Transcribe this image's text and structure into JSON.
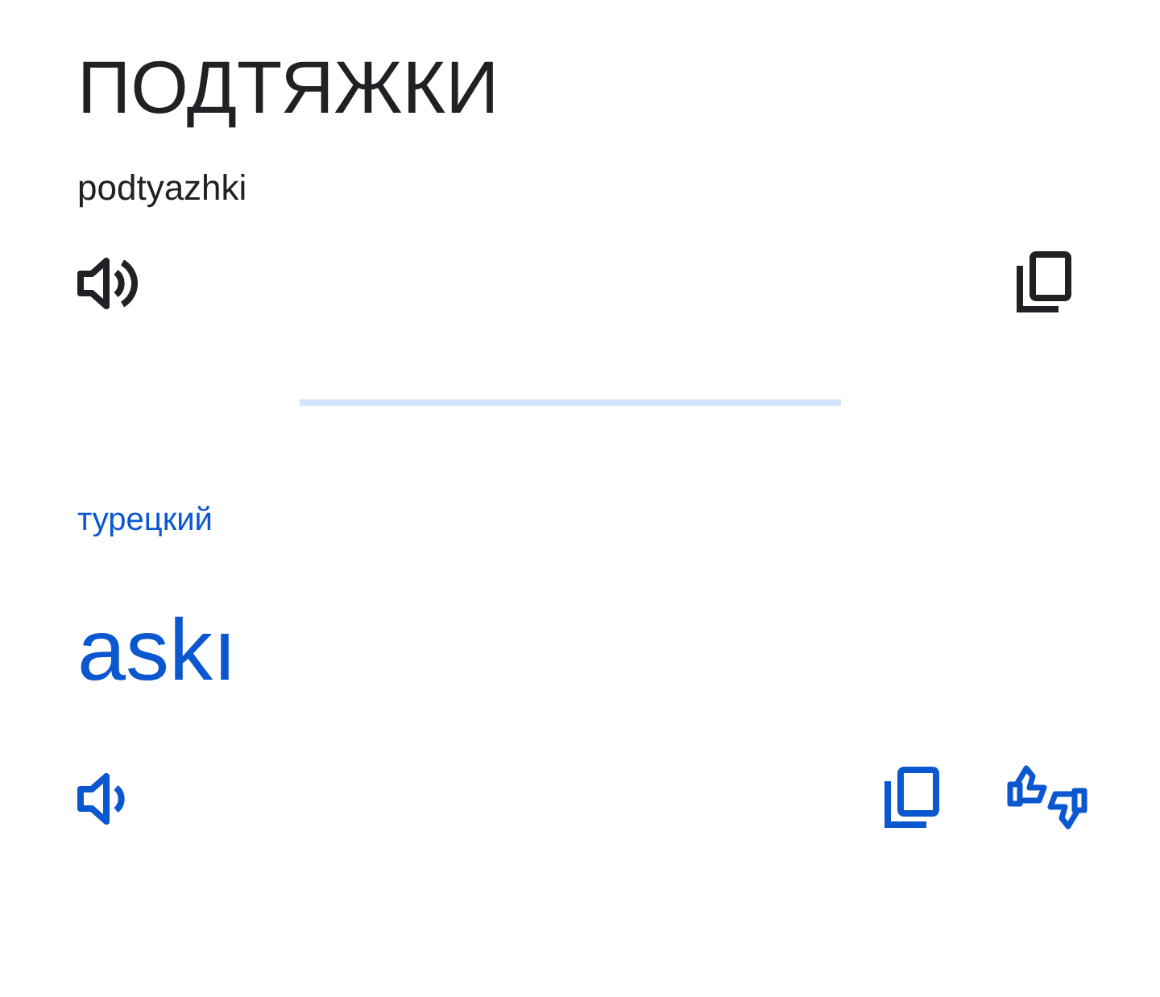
{
  "source": {
    "text": "ПОДТЯЖКИ",
    "transliteration": "podtyazhki"
  },
  "target": {
    "language": "турецкий",
    "text": "askı"
  }
}
